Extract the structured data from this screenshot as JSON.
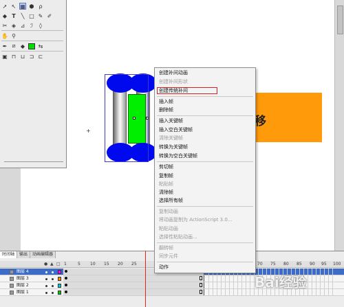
{
  "colors": {
    "orange": "#ff9a0a",
    "green": "#00ee00",
    "blue": "#0008ee",
    "playhead": "#e8201a",
    "highlight_border": "#d62020",
    "active_layer": "#3c6cc8"
  },
  "toolbox": {
    "tools": [
      "arrow-icon",
      "subselect-icon",
      "free-transform-icon",
      "lasso-icon",
      "pen-icon",
      "text-icon",
      "line-icon",
      "rectangle-icon",
      "pencil-icon",
      "brush-icon",
      "ink-bottle-icon",
      "paint-bucket-icon",
      "eyedropper-icon",
      "eraser-icon",
      "hand-icon",
      "zoom-icon",
      "stroke-color-icon",
      "fill-color-icon",
      "swap-colors-icon"
    ]
  },
  "stage": {
    "orange_glyph": "移"
  },
  "context_menu": {
    "items": [
      {
        "label": "创建补间动画",
        "enabled": true
      },
      {
        "label": "创建补间形状",
        "enabled": false
      },
      {
        "label": "创建传统补间",
        "enabled": true,
        "highlighted": true
      },
      {
        "label": "插入帧",
        "enabled": true
      },
      {
        "label": "删除帧",
        "enabled": true
      },
      {
        "label": "插入关键帧",
        "enabled": true
      },
      {
        "label": "插入空白关键帧",
        "enabled": true
      },
      {
        "label": "清除关键帧",
        "enabled": false
      },
      {
        "label": "转换为关键帧",
        "enabled": true
      },
      {
        "label": "转换为空白关键帧",
        "enabled": true
      },
      {
        "label": "剪切帧",
        "enabled": true
      },
      {
        "label": "复制帧",
        "enabled": true
      },
      {
        "label": "粘贴帧",
        "enabled": false
      },
      {
        "label": "清除帧",
        "enabled": true
      },
      {
        "label": "选择所有帧",
        "enabled": true
      },
      {
        "label": "复制动画",
        "enabled": false
      },
      {
        "label": "将动画复制为 ActionScript 3.0...",
        "enabled": false
      },
      {
        "label": "粘贴动画",
        "enabled": false
      },
      {
        "label": "选择性粘贴动画...",
        "enabled": false
      },
      {
        "label": "翻转帧",
        "enabled": false
      },
      {
        "label": "同步元件",
        "enabled": false
      },
      {
        "label": "动作",
        "enabled": true
      }
    ]
  },
  "timeline": {
    "tabs": [
      "时间轴",
      "输出",
      "动画编辑器"
    ],
    "ruler": [
      "1",
      "5",
      "10",
      "15",
      "20",
      "25",
      "70",
      "75",
      "80",
      "85",
      "90",
      "95",
      "100"
    ],
    "layers": [
      {
        "name": "图层 4",
        "active": true,
        "color": "#ff00ff"
      },
      {
        "name": "图层 3",
        "active": false,
        "color": "#ff8800"
      },
      {
        "name": "图层 2",
        "active": false,
        "color": "#00cccc"
      },
      {
        "name": "图层 1",
        "active": false,
        "color": "#00cc00"
      }
    ]
  },
  "watermark": "Bai经验"
}
